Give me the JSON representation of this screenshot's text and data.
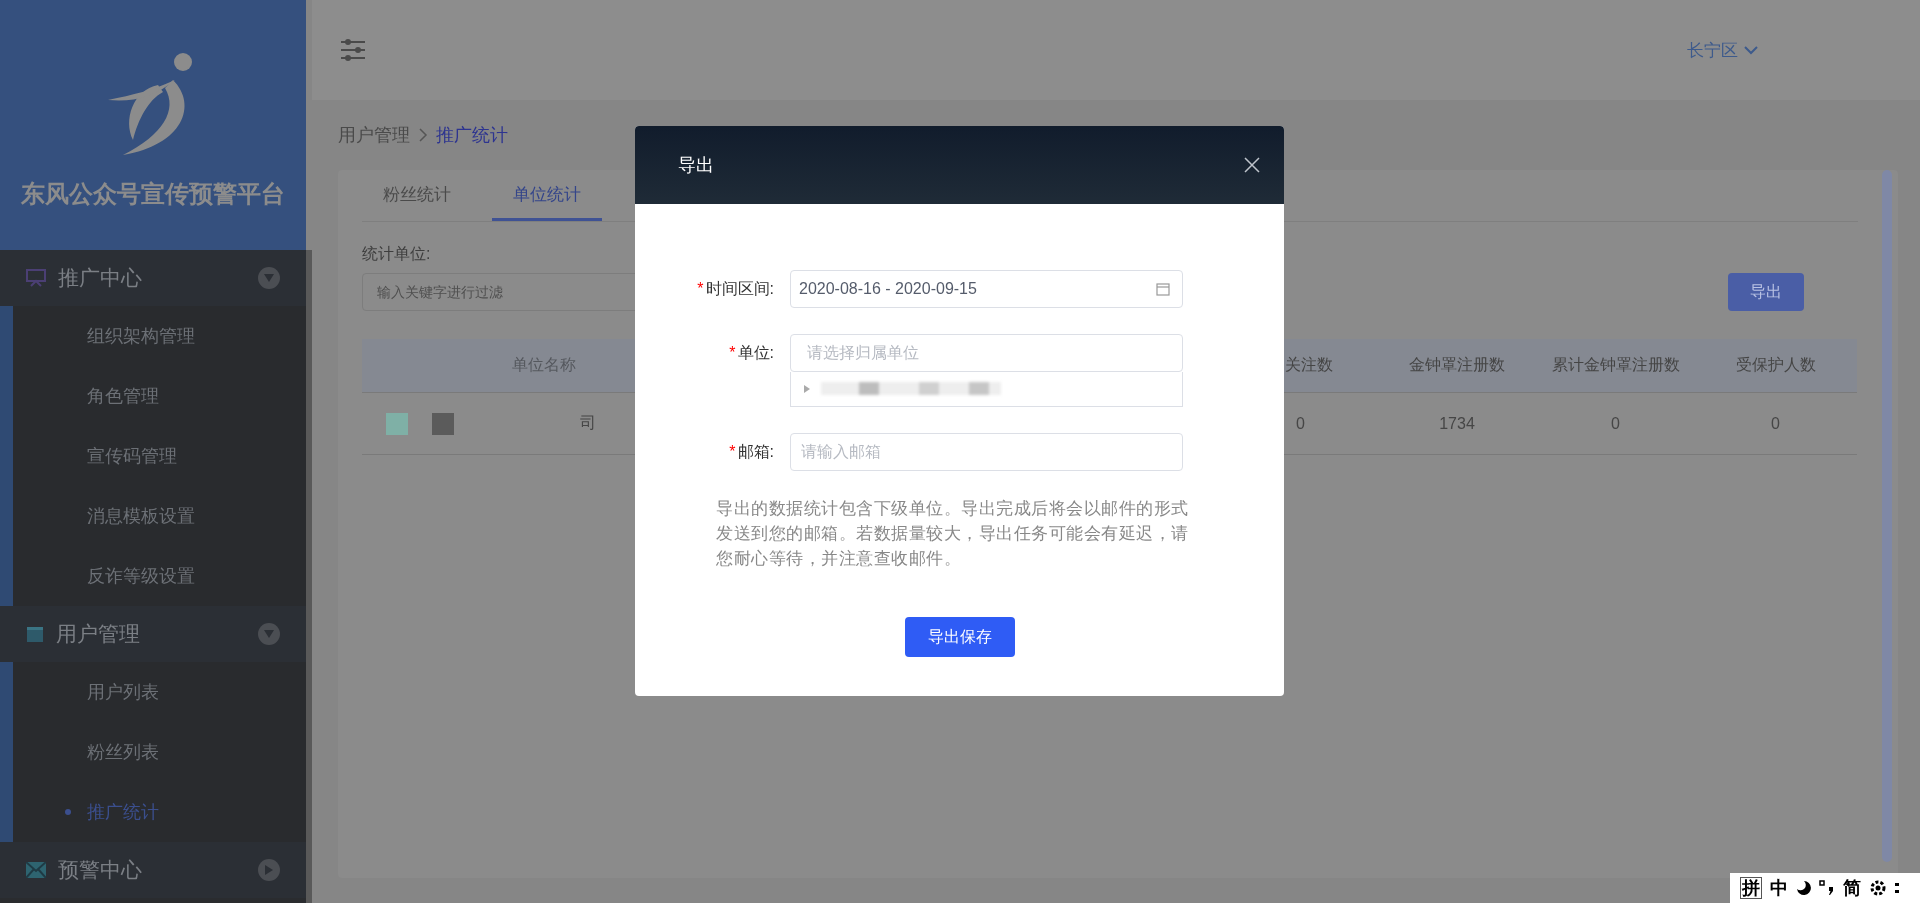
{
  "sidebar": {
    "title": "东风公众号宣传预警平台",
    "groups": [
      {
        "label": "推广中心",
        "kind": "board",
        "expanded": true,
        "items": [
          {
            "label": "组织架构管理",
            "selected": false
          },
          {
            "label": "角色管理",
            "selected": false
          },
          {
            "label": "宣传码管理",
            "selected": false
          },
          {
            "label": "消息模板设置",
            "selected": false
          },
          {
            "label": "反诈等级设置",
            "selected": false
          }
        ]
      },
      {
        "label": "用户管理",
        "kind": "calendar",
        "expanded": true,
        "items": [
          {
            "label": "用户列表",
            "selected": false
          },
          {
            "label": "粉丝列表",
            "selected": false
          },
          {
            "label": "推广统计",
            "selected": true
          }
        ]
      },
      {
        "label": "预警中心",
        "kind": "mail",
        "expanded": false
      }
    ]
  },
  "header": {
    "region": "长宁区"
  },
  "breadcrumb": [
    "用户管理",
    "推广统计"
  ],
  "tabs": [
    {
      "label": "粉丝统计",
      "selected": false
    },
    {
      "label": "单位统计",
      "selected": true
    }
  ],
  "filter": {
    "label": "统计单位:",
    "placeholder": "输入关键字进行过滤"
  },
  "export_button": "导出",
  "table": {
    "columns": [
      "单位名称",
      "关注数",
      "金钟罩注册数",
      "累计金钟罩注册数",
      "受保护人数"
    ],
    "rows": [
      {
        "cells": [
          "司",
          "0",
          "1734",
          "0",
          "0"
        ]
      }
    ]
  },
  "dialog": {
    "title": "导出",
    "fields": [
      {
        "kind": "date-range",
        "mark": "*",
        "label": "时间区间:",
        "value": "2020-08-16 - 2020-09-15"
      },
      {
        "kind": "tree-select",
        "mark": "*",
        "label": "单位:",
        "placeholder": "请选择归属单位",
        "options": [
          {
            "expanded": false
          }
        ]
      },
      {
        "kind": "text",
        "mark": "*",
        "label": "邮箱:",
        "placeholder": "请输入邮箱"
      }
    ],
    "note": "导出的数据统计包含下级单位。导出完成后将会以邮件的形式发送到您的邮箱。若数据量较大，导出任务可能会有延迟，请您耐心等待，并注意查收邮件。",
    "submit": "导出保存"
  },
  "ime_bar": {
    "items": [
      {
        "kind": "boxed",
        "label": "拼"
      },
      {
        "kind": "text",
        "label": "中"
      },
      {
        "kind": "moon"
      },
      {
        "kind": "punct"
      },
      {
        "kind": "text",
        "label": "简"
      },
      {
        "kind": "gear"
      },
      {
        "kind": "dots"
      }
    ]
  }
}
